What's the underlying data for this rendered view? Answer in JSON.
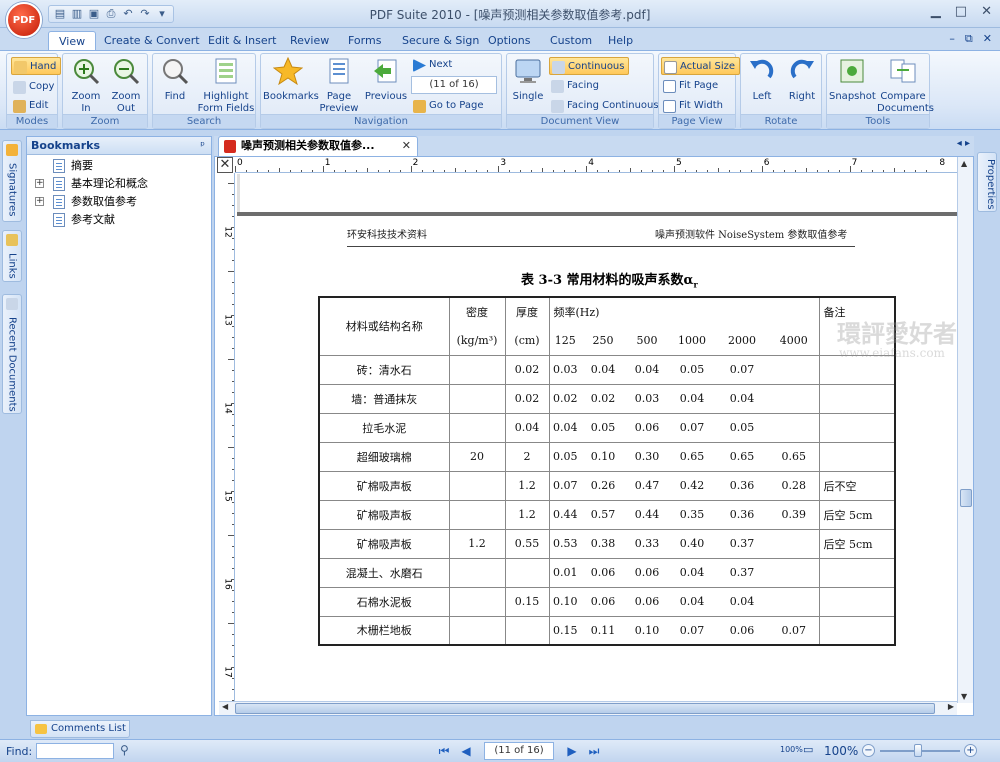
{
  "window": {
    "title": "PDF Suite 2010  - [噪声预测相关参数取值参考.pdf]",
    "app_logo": "PDF",
    "controls": [
      "▁",
      "□",
      "✕"
    ]
  },
  "tabs": [
    {
      "label": "View",
      "active": true
    },
    {
      "label": "Create & Convert"
    },
    {
      "label": "Edit & Insert"
    },
    {
      "label": "Review"
    },
    {
      "label": "Forms"
    },
    {
      "label": "Secure & Sign"
    },
    {
      "label": "Options"
    },
    {
      "label": "Custom"
    },
    {
      "label": "Help"
    }
  ],
  "tab_controls": [
    "–",
    "⧉",
    "✕"
  ],
  "ribbon": {
    "modes": {
      "label": "Modes",
      "hand": "Hand",
      "copy": "Copy",
      "edit": "Edit"
    },
    "zoom": {
      "label": "Zoom",
      "zoom_in": "Zoom\nIn",
      "zoom_in_1": "Zoom",
      "zoom_in_2": "In",
      "zoom_out_1": "Zoom",
      "zoom_out_2": "Out"
    },
    "search": {
      "label": "Search",
      "find": "Find",
      "highlight_1": "Highlight",
      "highlight_2": "Form Fields"
    },
    "navigation": {
      "label": "Navigation",
      "bookmarks": "Bookmarks",
      "page_preview_1": "Page",
      "page_preview_2": "Preview",
      "previous": "Previous",
      "next": "Next",
      "page_value": "(11 of 16)",
      "goto": "Go to Page"
    },
    "document_view": {
      "label": "Document View",
      "single": "Single",
      "continuous": "Continuous",
      "facing": "Facing",
      "facing_continuous": "Facing Continuous"
    },
    "page_view": {
      "label": "Page View",
      "actual_size": "Actual Size",
      "fit_page": "Fit Page",
      "fit_width": "Fit Width"
    },
    "rotate": {
      "label": "Rotate",
      "left": "Left",
      "right": "Right"
    },
    "tools": {
      "label": "Tools",
      "snapshot": "Snapshot",
      "compare_1": "Compare",
      "compare_2": "Documents"
    }
  },
  "side_tabs": {
    "signatures": "Signatures",
    "links": "Links",
    "recent": "Recent Documents",
    "properties": "Properties"
  },
  "bookmarks": {
    "title": "Bookmarks",
    "pin": "ᵖ",
    "items": [
      {
        "label": "摘要",
        "expandable": false
      },
      {
        "label": "基本理论和概念",
        "expandable": true
      },
      {
        "label": "参数取值参考",
        "expandable": true
      },
      {
        "label": "参考文献",
        "expandable": false
      }
    ]
  },
  "document": {
    "tab_title": "噪声预测相关参数取值参...",
    "close": "✕",
    "ruler_top": [
      "0",
      "1",
      "2",
      "3",
      "4",
      "5",
      "6",
      "7",
      "8"
    ],
    "ruler_left": [
      "12",
      "13",
      "14",
      "15",
      "16",
      "17"
    ],
    "header_left": "环安科技技术资料",
    "header_right": "噪声预测软件 NoiseSystem 参数取值参考",
    "table_title": "表 3-3 常用材料的吸声系数α",
    "table_title_sub": "r",
    "watermark": "環評愛好者",
    "watermark_sub": "www.eiafans.com",
    "table_header": {
      "name": "材料或结构名称",
      "density_1": "密度",
      "density_2": "(kg/m³)",
      "thickness_1": "厚度",
      "thickness_2": "(cm)",
      "freq": "频率(Hz)",
      "freqs": [
        "125",
        "250",
        "500",
        "1000",
        "2000",
        "4000"
      ],
      "note": "备注"
    },
    "rows": [
      {
        "name": "砖：清水石",
        "density": "",
        "thickness": "0.02",
        "v": [
          "0.03",
          "0.04",
          "0.04",
          "0.05",
          "0.07",
          ""
        ],
        "note": ""
      },
      {
        "name": "墙：普通抹灰",
        "density": "",
        "thickness": "0.02",
        "v": [
          "0.02",
          "0.02",
          "0.03",
          "0.04",
          "0.04",
          ""
        ],
        "note": ""
      },
      {
        "name": "拉毛水泥",
        "density": "",
        "thickness": "0.04",
        "v": [
          "0.04",
          "0.05",
          "0.06",
          "0.07",
          "0.05",
          ""
        ],
        "note": ""
      },
      {
        "name": "超细玻璃棉",
        "density": "20",
        "thickness": "2",
        "v": [
          "0.05",
          "0.10",
          "0.30",
          "0.65",
          "0.65",
          "0.65"
        ],
        "note": ""
      },
      {
        "name": "矿棉吸声板",
        "density": "",
        "thickness": "1.2",
        "v": [
          "0.07",
          "0.26",
          "0.47",
          "0.42",
          "0.36",
          "0.28"
        ],
        "note": "后不空"
      },
      {
        "name": "矿棉吸声板",
        "density": "",
        "thickness": "1.2",
        "v": [
          "0.44",
          "0.57",
          "0.44",
          "0.35",
          "0.36",
          "0.39"
        ],
        "note": "后空 5cm"
      },
      {
        "name": "矿棉吸声板",
        "density": "1.2",
        "thickness": "0.55",
        "v": [
          "0.53",
          "0.38",
          "0.33",
          "0.40",
          "0.37",
          ""
        ],
        "note": "后空 5cm"
      },
      {
        "name": "混凝土、水磨石",
        "density": "",
        "thickness": "",
        "v": [
          "0.01",
          "0.06",
          "0.06",
          "0.04",
          "0.37",
          ""
        ],
        "note": ""
      },
      {
        "name": "石棉水泥板",
        "density": "",
        "thickness": "0.15",
        "v": [
          "0.10",
          "0.06",
          "0.06",
          "0.04",
          "0.04",
          ""
        ],
        "note": ""
      },
      {
        "name": "木栅栏地板",
        "density": "",
        "thickness": "",
        "v": [
          "0.15",
          "0.11",
          "0.10",
          "0.07",
          "0.06",
          "0.07"
        ],
        "note": ""
      }
    ]
  },
  "comments_tab": "Comments List",
  "status": {
    "find_label": "Find:",
    "page_count": "(11 of 16)",
    "zoom": "100%",
    "zoom_small": "100%",
    "zoom_minus": "−",
    "zoom_plus": "+"
  }
}
